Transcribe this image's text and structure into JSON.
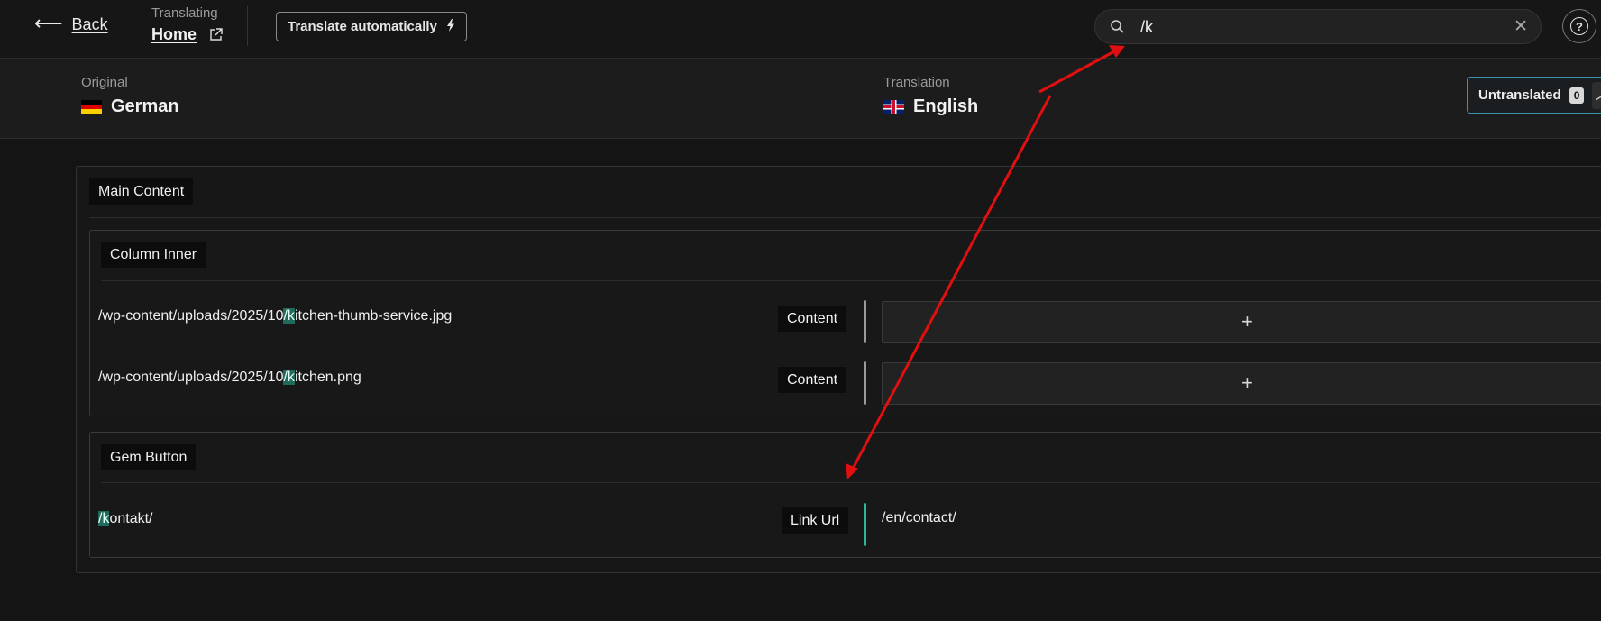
{
  "topbar": {
    "back_label": "Back",
    "translating_label": "Translating",
    "page_name": "Home",
    "translate_auto_label": "Translate automatically",
    "search_value": "/k"
  },
  "langbar": {
    "original_label": "Original",
    "original_lang": "German",
    "translation_label": "Translation",
    "translation_lang": "English",
    "filter_label": "Untranslated",
    "filter_count": "0"
  },
  "main": {
    "section_title": "Main Content",
    "groups": [
      {
        "title": "Column Inner",
        "rows": [
          {
            "pre": "/wp-content/uploads/2025/10",
            "match": "/k",
            "post": "itchen-thumb-service.jpg",
            "field": "Content",
            "translation": ""
          },
          {
            "pre": "/wp-content/uploads/2025/10",
            "match": "/k",
            "post": "itchen.png",
            "field": "Content",
            "translation": ""
          }
        ]
      },
      {
        "title": "Gem Button",
        "rows": [
          {
            "pre": "",
            "match": "/k",
            "post": "ontakt/",
            "field": "Link Url",
            "translation": "/en/contact/"
          }
        ]
      }
    ]
  },
  "colors": {
    "highlight": "#1f6b5c",
    "translated_bar": "#2db897",
    "annotation_arrow": "#e01010",
    "filter_border": "#3f8fae"
  },
  "icons": [
    "back-arrow-icon",
    "external-link-icon",
    "lightning-icon",
    "search-icon",
    "clear-icon",
    "help-icon",
    "chevron-up-icon",
    "plus-icon"
  ]
}
